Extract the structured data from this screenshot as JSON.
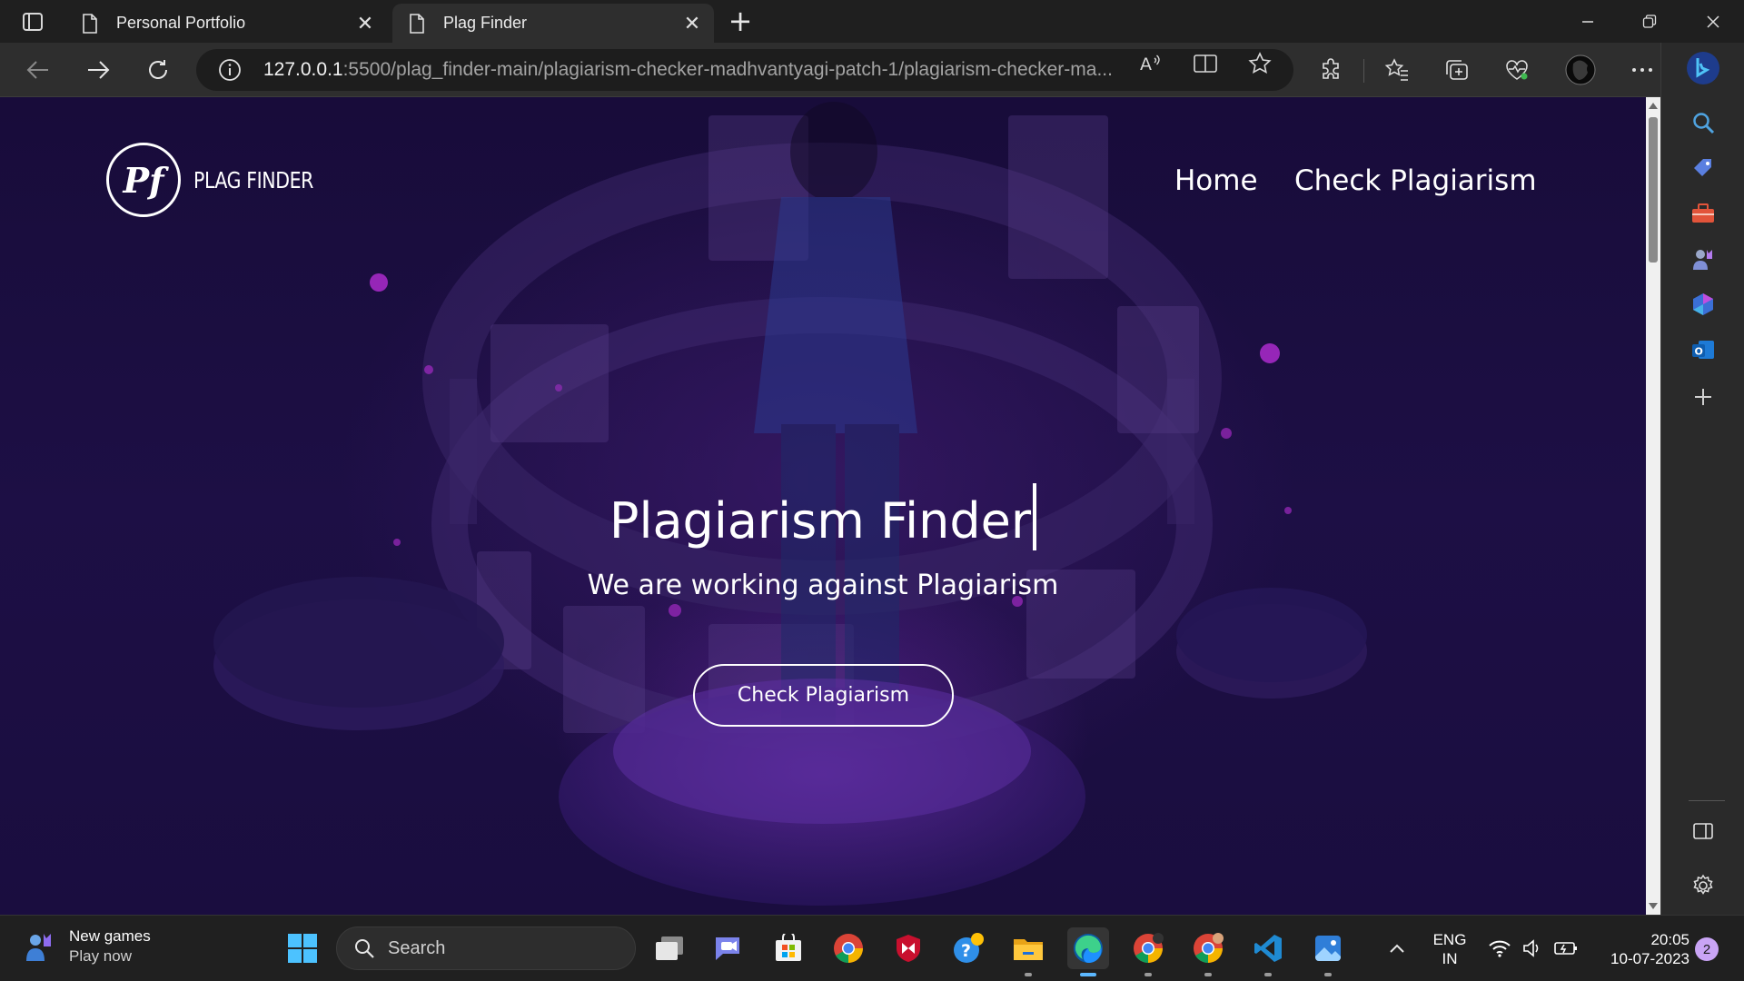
{
  "browser": {
    "tabs": [
      {
        "title": "Personal Portfolio",
        "active": false
      },
      {
        "title": "Plag Finder",
        "active": true
      }
    ],
    "url_host": "127.0.0.1",
    "url_rest": ":5500/plag_finder-main/plagiarism-checker-madhvantyagi-patch-1/plagiarism-checker-ma...",
    "read_aloud_icon": "read-aloud-icon",
    "accent": "#5cb8ff"
  },
  "site": {
    "logo_mark": "Pf",
    "logo_text": "PLAG FINDER",
    "nav": {
      "home": "Home",
      "check": "Check Plagiarism"
    },
    "hero_title": "Plagiarism Finder",
    "hero_subtitle": "We are working against Plagiarism",
    "cta_label": "Check Plagiarism",
    "background": "#1a0d3f"
  },
  "taskbar": {
    "widget_title": "New games",
    "widget_subtitle": "Play now",
    "search_label": "Search",
    "lang_line1": "ENG",
    "lang_line2": "IN",
    "time": "20:05",
    "date": "10-07-2023",
    "notification_count": "2"
  }
}
